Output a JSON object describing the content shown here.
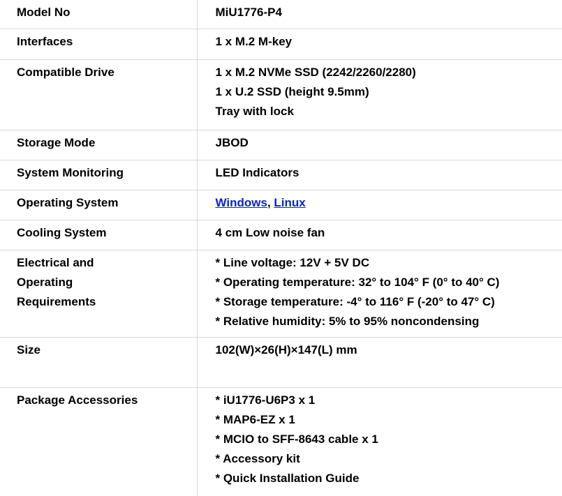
{
  "rows": [
    {
      "label": "Model No",
      "values": [
        "MiU1776-P4"
      ]
    },
    {
      "label": "Interfaces",
      "values": [
        "1 x M.2 M-key"
      ]
    },
    {
      "label": "Compatible Drive",
      "values": [
        "1 x M.2 NVMe SSD (2242/2260/2280)",
        "1 x U.2 SSD (height 9.5mm)",
        "Tray with lock"
      ]
    },
    {
      "label": "Storage Mode",
      "values": [
        "JBOD"
      ]
    },
    {
      "label": "System Monitoring",
      "values": [
        "LED Indicators"
      ]
    },
    {
      "label": "Operating System",
      "links": [
        "Windows",
        "Linux"
      ],
      "separator": ", "
    },
    {
      "label": "Cooling System",
      "values": [
        "4 cm Low noise fan"
      ]
    },
    {
      "label_lines": [
        "Electrical and",
        "Operating",
        "Requirements"
      ],
      "values": [
        "* Line voltage: 12V + 5V DC",
        "* Operating temperature: 32° to 104° F (0° to 40° C)",
        "* Storage temperature: -4° to 116° F (-20° to 47° C)",
        "* Relative humidity: 5% to 95% noncondensing"
      ]
    },
    {
      "label": "Size",
      "values": [
        "102(W)×26(H)×147(L) mm"
      ]
    },
    {
      "label": "Package Accessories",
      "values": [
        "* iU1776-U6P3 x 1",
        "* MAP6-EZ x 1",
        "* MCIO to SFF-8643 cable x 1",
        "* Accessory kit",
        "* Quick Installation Guide"
      ]
    }
  ],
  "colors": {
    "link": "#0b22d6",
    "divider": "#d9d9d9"
  }
}
